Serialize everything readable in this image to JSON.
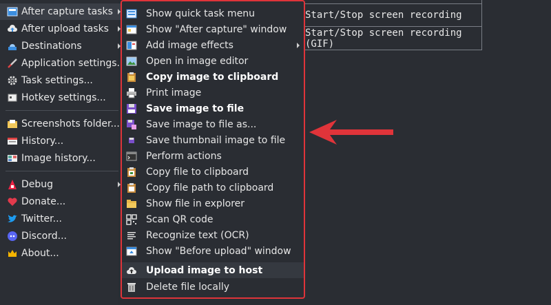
{
  "left_menu": {
    "items": [
      {
        "label": "After capture tasks",
        "icon": "after-capture-icon",
        "arrow": true,
        "active": true
      },
      {
        "label": "After upload tasks",
        "icon": "cloud-upload-icon",
        "arrow": true
      },
      {
        "label": "Destinations",
        "icon": "destinations-icon",
        "arrow": true
      },
      {
        "label": "Application settings...",
        "icon": "wrench-icon"
      },
      {
        "label": "Task settings...",
        "icon": "gear-icon"
      },
      {
        "label": "Hotkey settings...",
        "icon": "keyboard-icon"
      },
      {
        "label": "Screenshots folder...",
        "icon": "folder-icon"
      },
      {
        "label": "History...",
        "icon": "history-icon"
      },
      {
        "label": "Image history...",
        "icon": "image-history-icon"
      },
      {
        "label": "Debug",
        "icon": "debug-icon",
        "arrow": true
      },
      {
        "label": "Donate...",
        "icon": "heart-icon"
      },
      {
        "label": "Twitter...",
        "icon": "twitter-icon"
      },
      {
        "label": "Discord...",
        "icon": "discord-icon"
      },
      {
        "label": "About...",
        "icon": "crown-icon"
      }
    ]
  },
  "submenu": {
    "items": [
      {
        "label": "Show quick task menu",
        "icon": "quick-task-icon"
      },
      {
        "label": "Show \"After capture\" window",
        "icon": "window-icon"
      },
      {
        "label": "Add image effects",
        "icon": "image-effects-icon",
        "arrow": true
      },
      {
        "label": "Open in image editor",
        "icon": "image-editor-icon"
      },
      {
        "label": "Copy image to clipboard",
        "icon": "clipboard-image-icon",
        "bold": true
      },
      {
        "label": "Print image",
        "icon": "printer-icon"
      },
      {
        "label": "Save image to file",
        "icon": "floppy-icon",
        "bold": true
      },
      {
        "label": "Save image to file as...",
        "icon": "save-as-icon"
      },
      {
        "label": "Save thumbnail image to file",
        "icon": "thumbnail-icon"
      },
      {
        "label": "Perform actions",
        "icon": "terminal-icon"
      },
      {
        "label": "Copy file to clipboard",
        "icon": "copy-file-icon"
      },
      {
        "label": "Copy file path to clipboard",
        "icon": "copy-path-icon"
      },
      {
        "label": "Show file in explorer",
        "icon": "explorer-folder-icon"
      },
      {
        "label": "Scan QR code",
        "icon": "qr-code-icon"
      },
      {
        "label": "Recognize text (OCR)",
        "icon": "ocr-text-icon"
      },
      {
        "label": "Show \"Before upload\" window",
        "icon": "before-upload-icon"
      },
      {
        "label": "Upload image to host",
        "icon": "upload-cloud-icon",
        "bold": true,
        "hover": true
      },
      {
        "label": "Delete file locally",
        "icon": "trash-icon"
      }
    ]
  },
  "hotkeys": {
    "rows": [
      "Start/Stop screen recording",
      "Start/Stop screen recording (GIF)"
    ]
  },
  "colors": {
    "highlight_border": "#e0343a",
    "arrow": "#e0343a"
  }
}
